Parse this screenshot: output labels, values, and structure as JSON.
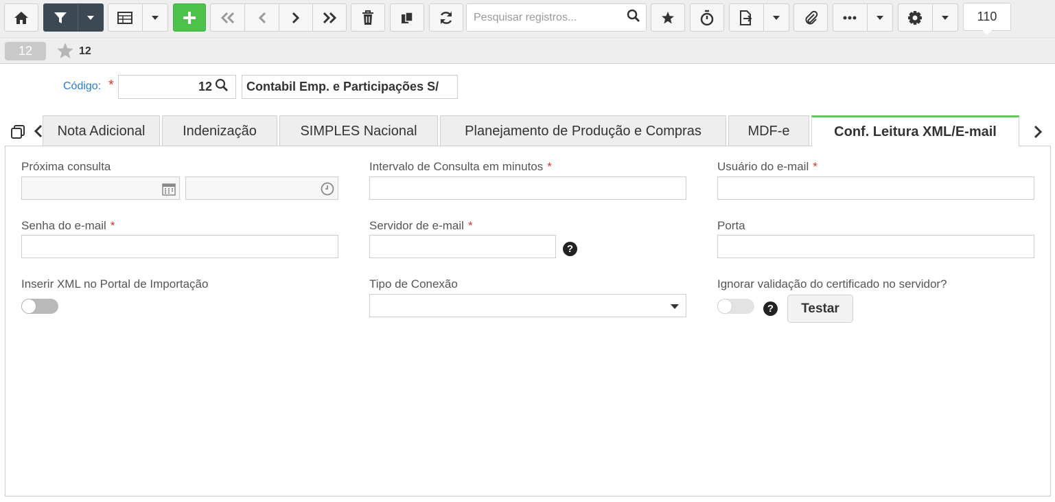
{
  "toolbar": {
    "search_placeholder": "Pesquisar registros...",
    "record_count": "110",
    "accent_green": "#4cc24a",
    "dark_button": "#3d4855",
    "icons": [
      "home-icon",
      "filter-icon",
      "chevron-down-icon",
      "table-icon",
      "plus-icon",
      "first-icon",
      "previous-icon",
      "next-icon",
      "last-icon",
      "trash-icon",
      "copy-icon",
      "refresh-icon",
      "search-icon",
      "star-icon",
      "timer-icon",
      "export-icon",
      "paperclip-icon",
      "more-icon",
      "gear-icon"
    ]
  },
  "record_bar": {
    "badge": "12",
    "favorite_number": "12"
  },
  "header": {
    "code_label": "Código:",
    "required_mark": "*",
    "code_value": "12",
    "company_name": "Contabil Emp. e Participações S/"
  },
  "tabs": [
    {
      "label": "Nota Adicional",
      "active": false
    },
    {
      "label": "Indenização",
      "active": false
    },
    {
      "label": "SIMPLES Nacional",
      "active": false
    },
    {
      "label": "Planejamento de Produção e Compras",
      "active": false
    },
    {
      "label": "MDF-e",
      "active": false
    },
    {
      "label": "Conf. Leitura XML/E-mail",
      "active": true
    }
  ],
  "form": {
    "proxima_consulta": {
      "label": "Próxima consulta",
      "date": "",
      "time": ""
    },
    "intervalo": {
      "label": "Intervalo de Consulta em minutos",
      "required": "*",
      "value": ""
    },
    "usuario": {
      "label": "Usuário do e-mail",
      "required": "*",
      "value": ""
    },
    "senha": {
      "label": "Senha do e-mail",
      "required": "*",
      "value": ""
    },
    "servidor": {
      "label": "Servidor de e-mail",
      "required": "*",
      "value": "",
      "help": "?"
    },
    "porta": {
      "label": "Porta",
      "value": ""
    },
    "inserir_xml": {
      "label": "Inserir XML no Portal de Importação",
      "on": false
    },
    "tipo_conexao": {
      "label": "Tipo de Conexão",
      "value": ""
    },
    "ignorar_validacao": {
      "label": "Ignorar validação do certificado no servidor?",
      "on": false,
      "help": "?"
    },
    "test_button": "Testar"
  }
}
